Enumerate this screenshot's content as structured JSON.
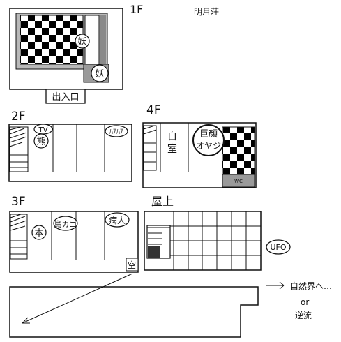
{
  "building_name": "明月荘",
  "floors": {
    "f1": {
      "label": "1F",
      "entrance": "出入口",
      "occupant_a": "妖",
      "occupant_b": "妖"
    },
    "f2": {
      "label": "2F",
      "tv": "TV",
      "bear": "熊",
      "haahaa": "ﾊｱﾊｱ"
    },
    "f3": {
      "label": "3F",
      "book": "本",
      "birdcage": "鳥カゴ",
      "sick": "病人",
      "vacant": "空"
    },
    "f4": {
      "label": "4F",
      "own_room": "自室",
      "big_face": "巨顔",
      "oyaji": "オヤジ",
      "wc": "WC"
    },
    "roof": {
      "label": "屋上",
      "ufo": "UFO"
    }
  },
  "exit": {
    "arrow": "→",
    "nature": "自然界へ…",
    "or": "or",
    "reverse": "逆流"
  }
}
